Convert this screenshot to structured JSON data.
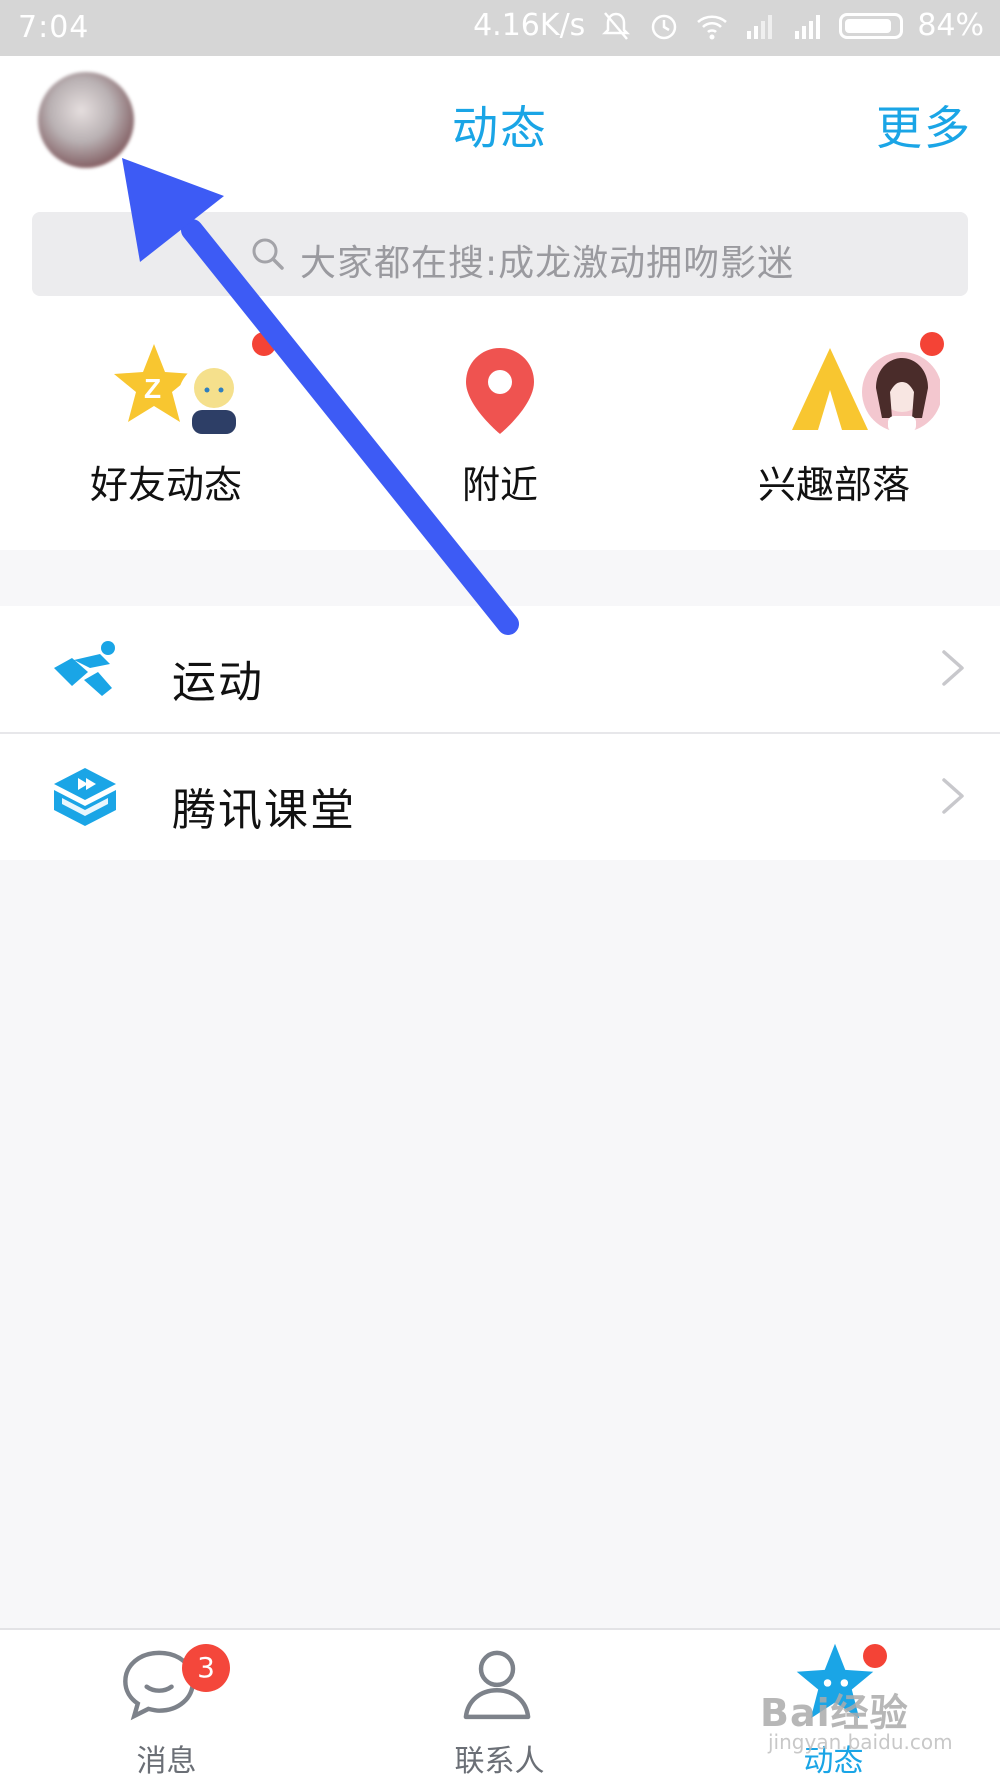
{
  "status_bar": {
    "time": "7:04",
    "network_speed": "4.16K/s",
    "battery": "84%",
    "icons": [
      "mute-bell-icon",
      "alarm-icon",
      "wifi-icon",
      "signal-icon",
      "signal-icon",
      "battery-icon"
    ]
  },
  "header": {
    "title": "动态",
    "more_label": "更多"
  },
  "search": {
    "placeholder": "大家都在搜:成龙激动拥吻影迷"
  },
  "shortcuts": [
    {
      "label": "好友动态",
      "icon": "qzone-star-icon",
      "has_dot": true
    },
    {
      "label": "附近",
      "icon": "location-pin-icon",
      "has_dot": false
    },
    {
      "label": "兴趣部落",
      "icon": "tent-icon",
      "has_dot": true
    }
  ],
  "list": [
    {
      "label": "运动",
      "icon": "running-icon"
    },
    {
      "label": "腾讯课堂",
      "icon": "tencent-classroom-icon"
    }
  ],
  "tabs": [
    {
      "label": "消息",
      "icon": "chat-bubble-icon",
      "badge": "3"
    },
    {
      "label": "联系人",
      "icon": "contact-person-icon"
    },
    {
      "label": "动态",
      "icon": "star-icon",
      "has_dot": true,
      "active": true
    }
  ],
  "colors": {
    "accent": "#1aa5e6",
    "badge": "#f4473b",
    "arrow": "#3d5bf5"
  },
  "watermark": {
    "brand": "Bai经验",
    "url": "jingyan.baidu.com"
  }
}
